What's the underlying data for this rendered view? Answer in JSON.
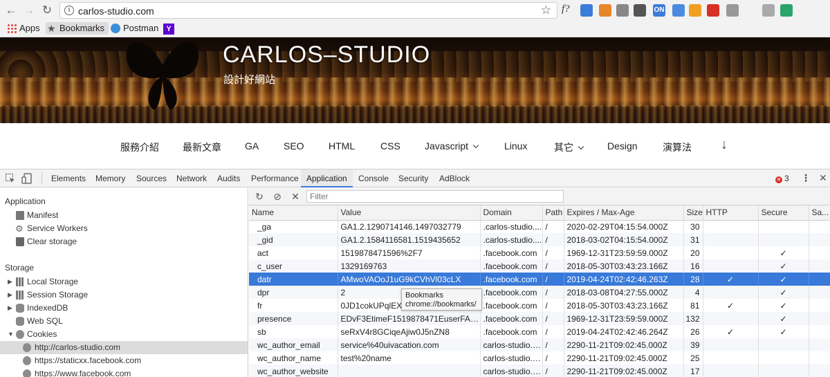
{
  "browser": {
    "url": "carlos-studio.com",
    "bookmarks": [
      "Apps",
      "Bookmarks",
      "Postman",
      "Y"
    ],
    "extension_label": "f?",
    "extensions": [
      {
        "icon": "extension-blue-icon",
        "color": "#3b7dd8"
      },
      {
        "icon": "extension-orange-icon",
        "color": "#e8862a"
      },
      {
        "icon": "extension-globe-icon",
        "color": "#888888"
      },
      {
        "icon": "extension-sync-icon",
        "color": "#555555"
      },
      {
        "icon": "extension-on-icon",
        "color": "#3b7dd8",
        "text": "ON"
      },
      {
        "icon": "extension-translate-icon",
        "color": "#4a8be0"
      },
      {
        "icon": "extension-chart-icon",
        "color": "#f0a020"
      },
      {
        "icon": "extension-hash-icon",
        "color": "#d93025"
      },
      {
        "icon": "extension-vue-icon",
        "color": "#999999"
      },
      {
        "icon": "extension-chat-icon",
        "color": "#aaaaaa"
      },
      {
        "icon": "extension-bracket-icon",
        "color": "#2aa46a"
      }
    ]
  },
  "site": {
    "title": "CARLOS–STUDIO",
    "subtitle": "設計好網站",
    "nav": [
      "服務介紹",
      "最新文章",
      "GA",
      "SEO",
      "HTML",
      "CSS",
      "Javascript",
      "Linux",
      "其它",
      "Design",
      "演算法"
    ],
    "nav_arrow": "↓"
  },
  "devtools": {
    "tabs": [
      "Elements",
      "Memory",
      "Sources",
      "Network",
      "Audits",
      "Performance",
      "Application",
      "Console",
      "Security",
      "AdBlock"
    ],
    "active_tab": "Application",
    "error_count": "3",
    "sidebar": {
      "application_header": "Application",
      "application_items": [
        "Manifest",
        "Service Workers",
        "Clear storage"
      ],
      "storage_header": "Storage",
      "storage_items": [
        "Local Storage",
        "Session Storage",
        "IndexedDB",
        "Web SQL",
        "Cookies"
      ],
      "cookie_origins": [
        "http://carlos-studio.com",
        "https://staticxx.facebook.com",
        "https://www.facebook.com"
      ]
    },
    "filter_placeholder": "Filter",
    "columns": [
      "Name",
      "Value",
      "Domain",
      "Path",
      "Expires / Max-Age",
      "Size",
      "HTTP",
      "Secure",
      "Sa..."
    ],
    "rows": [
      {
        "name": "_ga",
        "value": "GA1.2.1290714146.1497032779",
        "domain": ".carlos-studio....",
        "path": "/",
        "expires": "2020-02-29T04:15:54.000Z",
        "size": "30",
        "http": "",
        "secure": ""
      },
      {
        "name": "_gid",
        "value": "GA1.2.1584116581.1519435652",
        "domain": ".carlos-studio....",
        "path": "/",
        "expires": "2018-03-02T04:15:54.000Z",
        "size": "31",
        "http": "",
        "secure": ""
      },
      {
        "name": "act",
        "value": "1519878471596%2F7",
        "domain": ".facebook.com",
        "path": "/",
        "expires": "1969-12-31T23:59:59.000Z",
        "size": "20",
        "http": "",
        "secure": "✓"
      },
      {
        "name": "c_user",
        "value": "1329169763",
        "domain": ".facebook.com",
        "path": "/",
        "expires": "2018-05-30T03:43:23.166Z",
        "size": "16",
        "http": "",
        "secure": "✓"
      },
      {
        "name": "datr",
        "value": "AMwoVAOoJ1uG9kCVhVl03cLX",
        "domain": ".facebook.com",
        "path": "/",
        "expires": "2019-04-24T02:42:46.263Z",
        "size": "28",
        "http": "✓",
        "secure": "✓"
      },
      {
        "name": "dpr",
        "value": "2",
        "domain": ".facebook.com",
        "path": "/",
        "expires": "2018-03-08T04:27:55.000Z",
        "size": "4",
        "http": "",
        "secure": "✓"
      },
      {
        "name": "fr",
        "value": "0JD1cokUPqlEXv0...",
        "domain": ".facebook.com",
        "path": "/",
        "expires": "2018-05-30T03:43:23.166Z",
        "size": "81",
        "http": "✓",
        "secure": "✓"
      },
      {
        "name": "presence",
        "value": "EDvF3EtimeF1519878471EuserFA213...",
        "domain": ".facebook.com",
        "path": "/",
        "expires": "1969-12-31T23:59:59.000Z",
        "size": "132",
        "http": "",
        "secure": "✓"
      },
      {
        "name": "sb",
        "value": "seRxV4r8GCiqeAjiw0J5nZN8",
        "domain": ".facebook.com",
        "path": "/",
        "expires": "2019-04-24T02:42:46.264Z",
        "size": "26",
        "http": "✓",
        "secure": "✓"
      },
      {
        "name": "wc_author_email",
        "value": "service%40uivacation.com",
        "domain": "carlos-studio.c...",
        "path": "/",
        "expires": "2290-11-21T09:02:45.000Z",
        "size": "39",
        "http": "",
        "secure": ""
      },
      {
        "name": "wc_author_name",
        "value": "test%20name",
        "domain": "carlos-studio.c...",
        "path": "/",
        "expires": "2290-11-21T09:02:45.000Z",
        "size": "25",
        "http": "",
        "secure": ""
      },
      {
        "name": "wc_author_website",
        "value": "",
        "domain": "carlos-studio.c...",
        "path": "/",
        "expires": "2290-11-21T09:02:45.000Z",
        "size": "17",
        "http": "",
        "secure": ""
      }
    ],
    "selected_row": 4,
    "tooltip": {
      "title": "Bookmarks",
      "url": "chrome://bookmarks/"
    }
  },
  "colors": {
    "selection": "#3879d9",
    "banner_title": "#ffffff"
  }
}
